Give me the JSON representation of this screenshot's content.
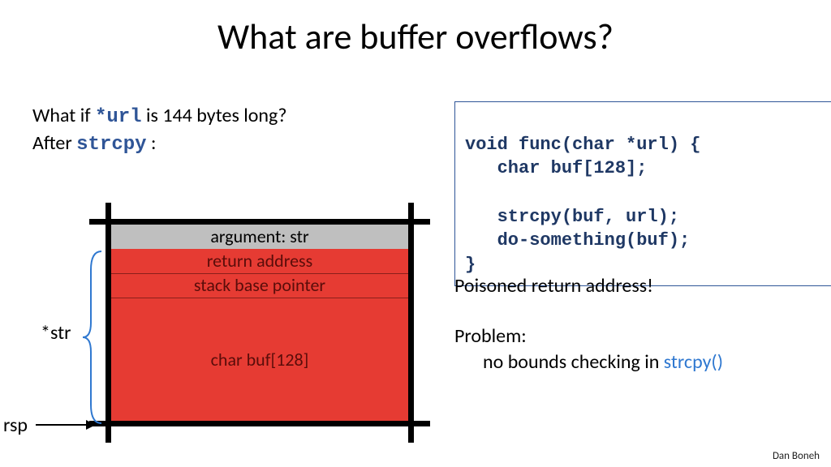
{
  "title": "What are buffer overflows?",
  "question": {
    "prefix": "What if ",
    "code": "*url",
    "suffix": " is  144 bytes long?"
  },
  "after": {
    "prefix": "After  ",
    "code": "strcpy",
    "suffix": ":"
  },
  "code": {
    "l1": "void func(char *url) {",
    "l2": "   char buf[128];",
    "l3": "   strcpy(buf, url);",
    "l4": "   do-something(buf);",
    "l5": "}"
  },
  "poison": "Poisoned return address!",
  "problem": {
    "label": "Problem:",
    "detail_prefix": "no bounds checking in  ",
    "detail_code": "strcpy()"
  },
  "stack": {
    "arg": "argument:   str",
    "ret": "return address",
    "sbp": "stack base pointer",
    "buf": "char buf[128]"
  },
  "labels": {
    "star_str": "*str",
    "rsp": "rsp"
  },
  "footer": "Dan Boneh"
}
